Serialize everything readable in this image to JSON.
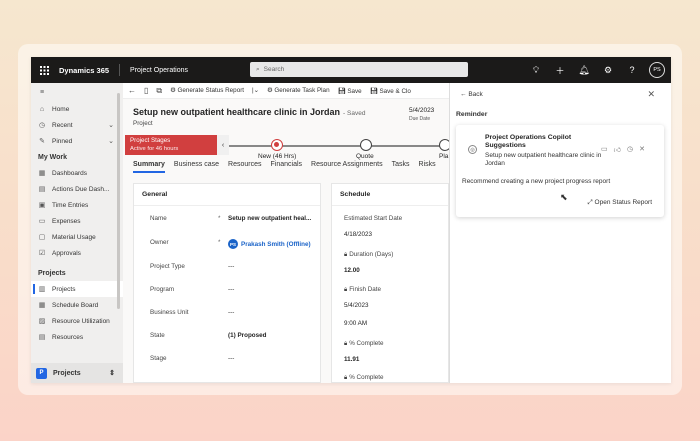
{
  "topbar": {
    "brand": "Dynamics 365",
    "app_name": "Project Operations",
    "search_placeholder": "Search",
    "avatar_initials": "PS",
    "icons": [
      "lightbulb-icon",
      "plus-icon",
      "bell-icon",
      "gear-icon",
      "help-icon"
    ]
  },
  "sidebar": {
    "items": [
      {
        "label": "Home",
        "icon": "home-icon"
      },
      {
        "label": "Recent",
        "icon": "clock-icon"
      },
      {
        "label": "Pinned",
        "icon": "pin-icon"
      }
    ],
    "my_work_heading": "My Work",
    "my_work": [
      {
        "label": "Dashboards",
        "icon": "dashboard-icon"
      },
      {
        "label": "Actions Due Dash...",
        "icon": "actions-icon"
      },
      {
        "label": "Time Entries",
        "icon": "calendar-icon"
      },
      {
        "label": "Expenses",
        "icon": "receipt-icon"
      },
      {
        "label": "Material Usage",
        "icon": "box-icon"
      },
      {
        "label": "Approvals",
        "icon": "approval-icon"
      }
    ],
    "projects_heading": "Projects",
    "projects": [
      {
        "label": "Projects",
        "icon": "project-icon",
        "selected": true
      },
      {
        "label": "Schedule Board",
        "icon": "board-icon"
      },
      {
        "label": "Resource Utilization",
        "icon": "chart-icon"
      },
      {
        "label": "Resources",
        "icon": "people-icon"
      }
    ],
    "area_badge": "P",
    "area_label": "Projects"
  },
  "commandbar": {
    "generate_status": "Generate Status Report",
    "generate_task": "Generate Task Plan",
    "save": "Save",
    "save_close": "Save & Clo"
  },
  "record": {
    "title": "Setup new outpatient healthcare clinic in Jordan",
    "saved": "- Saved",
    "entity": "Project",
    "due_date": "5/4/2023",
    "due_label": "Due Date"
  },
  "stages": {
    "active_title": "Project Stages",
    "active_sub": "Active for 46 hours",
    "nodes": [
      "New (46 Hrs)",
      "Quote",
      "Pla"
    ]
  },
  "tabs": [
    "Summary",
    "Business case",
    "Resources",
    "Financials",
    "Resource Assignments",
    "Tasks",
    "Risks"
  ],
  "general": {
    "title": "General",
    "fields": [
      {
        "label": "Name",
        "req": "*",
        "value": "Setup new outpatient heal..."
      },
      {
        "label": "Owner",
        "req": "*",
        "value": "Prakash Smith (Offline)",
        "badge": "PS"
      },
      {
        "label": "Project Type",
        "req": "",
        "value": "---"
      },
      {
        "label": "Program",
        "req": "",
        "value": "---"
      },
      {
        "label": "Business Unit",
        "req": "",
        "value": "---"
      },
      {
        "label": "State",
        "req": "",
        "value": "(1) Proposed"
      },
      {
        "label": "Stage",
        "req": "",
        "value": "---"
      }
    ]
  },
  "schedule": {
    "title": "Schedule",
    "rows": [
      {
        "label": "Estimated Start Date",
        "value": "4/18/2023"
      },
      {
        "label": "Duration (Days)",
        "value": "12.00"
      },
      {
        "label": "Finish Date",
        "value": "5/4/2023"
      },
      {
        "label": "",
        "value": "9:00 AM"
      },
      {
        "label": "% Complete",
        "value": "11.91"
      },
      {
        "label": "% Complete",
        "value": ""
      }
    ]
  },
  "panel": {
    "back": "Back",
    "reminder": "Reminder",
    "card_title": "Project Operations Copilot Suggestions",
    "card_body": "Setup new outpatient healthcare clinic in Jordan",
    "recommend": "Recommend creating a new project progress report",
    "open_button": "Open Status Report"
  }
}
